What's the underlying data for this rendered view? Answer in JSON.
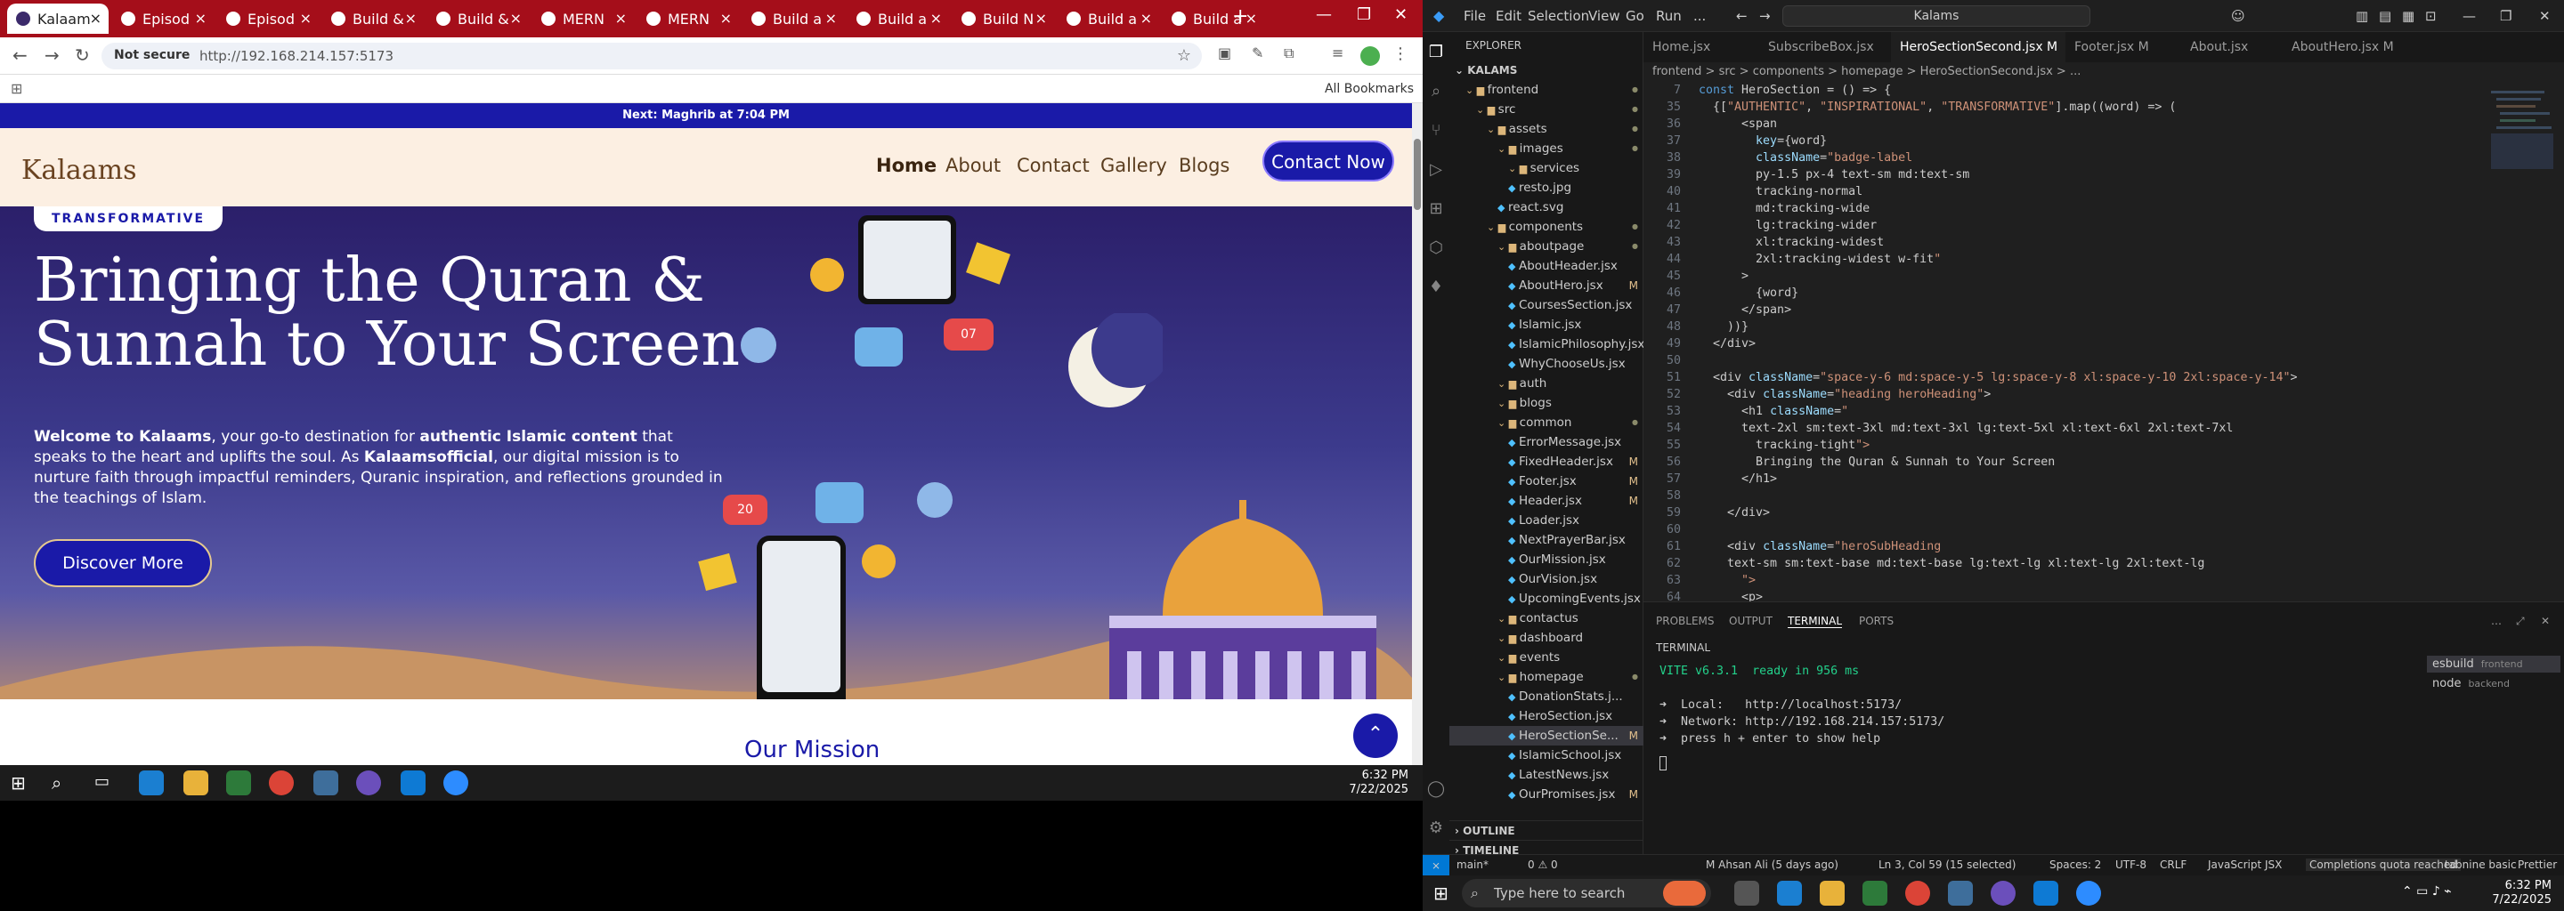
{
  "chrome": {
    "tabs": [
      {
        "label": "Kalaam",
        "active": true
      },
      {
        "label": "Episod",
        "active": false
      },
      {
        "label": "Episod",
        "active": false
      },
      {
        "label": "Build &",
        "active": false
      },
      {
        "label": "Build &",
        "active": false
      },
      {
        "label": "MERN",
        "active": false
      },
      {
        "label": "MERN",
        "active": false
      },
      {
        "label": "Build a",
        "active": false
      },
      {
        "label": "Build a",
        "active": false
      },
      {
        "label": "Build N",
        "active": false
      },
      {
        "label": "Build a",
        "active": false
      },
      {
        "label": "Build a",
        "active": false
      }
    ],
    "new_tab": "+",
    "not_secure": "Not secure",
    "url": "http://192.168.214.157:5173",
    "all_bookmarks": "All Bookmarks"
  },
  "site": {
    "prayer_bar": "Next: Maghrib at 7:04 PM",
    "logo": "Kalaams",
    "nav": [
      "Home",
      "About",
      "Contact",
      "Gallery",
      "Blogs"
    ],
    "cta": "Contact Now",
    "badge": "TRANSFORMATIVE",
    "hero_title": "Bringing the Quran & Sunnah to Your Screen",
    "hero_sub_1": "Welcome to Kalaams",
    "hero_sub_2": ", your go-to destination for ",
    "hero_sub_3": "authentic Islamic content",
    "hero_sub_4": " that speaks to the heart and uplifts the soul. As ",
    "hero_sub_5": "Kalaamsofficial",
    "hero_sub_6": ", our digital mission is to nurture faith through impactful reminders, Quranic inspiration, and reflections grounded in the teachings of Islam.",
    "discover": "Discover More",
    "mission_title": "Our Mission",
    "bubble_count_1": "20",
    "bubble_count_2": "07"
  },
  "left_taskbar": {
    "time": "6:32 PM",
    "date": "7/22/2025"
  },
  "vscode": {
    "menus": [
      "File",
      "Edit",
      "Selection",
      "View",
      "Go",
      "Run",
      "..."
    ],
    "command_center": "Kalams",
    "explorer_title": "EXPLORER",
    "workspace": "KALAMS",
    "tree": [
      {
        "label": "frontend",
        "indent": 1,
        "type": "folder",
        "mod": "dot"
      },
      {
        "label": "src",
        "indent": 2,
        "type": "folder",
        "mod": "dot"
      },
      {
        "label": "assets",
        "indent": 3,
        "type": "folder",
        "mod": "dot"
      },
      {
        "label": "images",
        "indent": 4,
        "type": "folder",
        "mod": "dot"
      },
      {
        "label": "services",
        "indent": 5,
        "type": "folder",
        "mod": ""
      },
      {
        "label": "resto.jpg",
        "indent": 5,
        "type": "file",
        "mod": ""
      },
      {
        "label": "react.svg",
        "indent": 4,
        "type": "file",
        "mod": ""
      },
      {
        "label": "components",
        "indent": 3,
        "type": "folder",
        "mod": "dot"
      },
      {
        "label": "aboutpage",
        "indent": 4,
        "type": "folder",
        "mod": "dot"
      },
      {
        "label": "AboutHeader.jsx",
        "indent": 5,
        "type": "file",
        "mod": ""
      },
      {
        "label": "AboutHero.jsx",
        "indent": 5,
        "type": "file",
        "mod": "M"
      },
      {
        "label": "CoursesSection.jsx",
        "indent": 5,
        "type": "file",
        "mod": ""
      },
      {
        "label": "Islamic.jsx",
        "indent": 5,
        "type": "file",
        "mod": ""
      },
      {
        "label": "IslamicPhilosophy.jsx",
        "indent": 5,
        "type": "file",
        "mod": ""
      },
      {
        "label": "WhyChooseUs.jsx",
        "indent": 5,
        "type": "file",
        "mod": ""
      },
      {
        "label": "auth",
        "indent": 4,
        "type": "folder",
        "mod": ""
      },
      {
        "label": "blogs",
        "indent": 4,
        "type": "folder",
        "mod": ""
      },
      {
        "label": "common",
        "indent": 4,
        "type": "folder",
        "mod": "dot"
      },
      {
        "label": "ErrorMessage.jsx",
        "indent": 5,
        "type": "file",
        "mod": ""
      },
      {
        "label": "FixedHeader.jsx",
        "indent": 5,
        "type": "file",
        "mod": "M"
      },
      {
        "label": "Footer.jsx",
        "indent": 5,
        "type": "file",
        "mod": "M"
      },
      {
        "label": "Header.jsx",
        "indent": 5,
        "type": "file",
        "mod": "M"
      },
      {
        "label": "Loader.jsx",
        "indent": 5,
        "type": "file",
        "mod": ""
      },
      {
        "label": "NextPrayerBar.jsx",
        "indent": 5,
        "type": "file",
        "mod": ""
      },
      {
        "label": "OurMission.jsx",
        "indent": 5,
        "type": "file",
        "mod": ""
      },
      {
        "label": "OurVision.jsx",
        "indent": 5,
        "type": "file",
        "mod": ""
      },
      {
        "label": "UpcomingEvents.jsx",
        "indent": 5,
        "type": "file",
        "mod": ""
      },
      {
        "label": "contactus",
        "indent": 4,
        "type": "folder",
        "mod": ""
      },
      {
        "label": "dashboard",
        "indent": 4,
        "type": "folder",
        "mod": ""
      },
      {
        "label": "events",
        "indent": 4,
        "type": "folder",
        "mod": ""
      },
      {
        "label": "homepage",
        "indent": 4,
        "type": "folder",
        "mod": "dot"
      },
      {
        "label": "DonationStats.j...",
        "indent": 5,
        "type": "file",
        "mod": ""
      },
      {
        "label": "HeroSection.jsx",
        "indent": 5,
        "type": "file",
        "mod": ""
      },
      {
        "label": "HeroSectionSe...",
        "indent": 5,
        "type": "file",
        "mod": "M",
        "selected": true
      },
      {
        "label": "IslamicSchool.jsx",
        "indent": 5,
        "type": "file",
        "mod": ""
      },
      {
        "label": "LatestNews.jsx",
        "indent": 5,
        "type": "file",
        "mod": ""
      },
      {
        "label": "OurPromises.jsx",
        "indent": 5,
        "type": "file",
        "mod": "M"
      }
    ],
    "outline": "OUTLINE",
    "timeline": "TIMELINE",
    "editor_tabs": [
      {
        "label": "Home.jsx",
        "active": false
      },
      {
        "label": "SubscribeBox.jsx",
        "active": false
      },
      {
        "label": "HeroSectionSecond.jsx M",
        "active": true
      },
      {
        "label": "Footer.jsx M",
        "active": false
      },
      {
        "label": "About.jsx",
        "active": false
      },
      {
        "label": "AboutHero.jsx M",
        "active": false
      }
    ],
    "breadcrumbs": "frontend > src > components > homepage > HeroSectionSecond.jsx > ...",
    "code_lines": [
      {
        "n": "7",
        "t": "const HeroSection = () => {"
      },
      {
        "n": "35",
        "t": "  {[\"AUTHENTIC\", \"INSPIRATIONAL\", \"TRANSFORMATIVE\"].map((word) => ("
      },
      {
        "n": "36",
        "t": "      <span"
      },
      {
        "n": "37",
        "t": "        key={word}"
      },
      {
        "n": "38",
        "t": "        className=\"badge-label"
      },
      {
        "n": "39",
        "t": "        py-1.5 px-4 text-sm md:text-sm"
      },
      {
        "n": "40",
        "t": "        tracking-normal"
      },
      {
        "n": "41",
        "t": "        md:tracking-wide"
      },
      {
        "n": "42",
        "t": "        lg:tracking-wider"
      },
      {
        "n": "43",
        "t": "        xl:tracking-widest"
      },
      {
        "n": "44",
        "t": "        2xl:tracking-widest w-fit\""
      },
      {
        "n": "45",
        "t": "      >"
      },
      {
        "n": "46",
        "t": "        {word}"
      },
      {
        "n": "47",
        "t": "      </span>"
      },
      {
        "n": "48",
        "t": "    ))}"
      },
      {
        "n": "49",
        "t": "  </div>"
      },
      {
        "n": "50",
        "t": ""
      },
      {
        "n": "51",
        "t": "  <div className=\"space-y-6 md:space-y-5 lg:space-y-8 xl:space-y-10 2xl:space-y-14\">"
      },
      {
        "n": "52",
        "t": "    <div className=\"heading heroHeading\">"
      },
      {
        "n": "53",
        "t": "      <h1 className=\""
      },
      {
        "n": "54",
        "t": "      text-2xl sm:text-3xl md:text-3xl lg:text-5xl xl:text-6xl 2xl:text-7xl"
      },
      {
        "n": "55",
        "t": "        tracking-tight\">"
      },
      {
        "n": "56",
        "t": "        Bringing the Quran & Sunnah to Your Screen"
      },
      {
        "n": "57",
        "t": "      </h1>"
      },
      {
        "n": "58",
        "t": ""
      },
      {
        "n": "59",
        "t": "    </div>"
      },
      {
        "n": "60",
        "t": ""
      },
      {
        "n": "61",
        "t": "    <div className=\"heroSubHeading"
      },
      {
        "n": "62",
        "t": "    text-sm sm:text-base md:text-base lg:text-lg xl:text-lg 2xl:text-lg"
      },
      {
        "n": "63",
        "t": "      \">"
      },
      {
        "n": "64",
        "t": "      <p>"
      }
    ],
    "panel_tabs": [
      "PROBLEMS",
      "OUTPUT",
      "TERMINAL",
      "PORTS"
    ],
    "terminal_label": "TERMINAL",
    "terminal": [
      "VITE v6.3.1  ready in 956 ms",
      "",
      "➜  Local:   http://localhost:5173/",
      "➜  Network: http://192.168.214.157:5173/",
      "➜  press h + enter to show help"
    ],
    "terminal_list": [
      {
        "label": "esbuild",
        "sub": "frontend"
      },
      {
        "label": "node",
        "sub": "backend"
      }
    ],
    "status": {
      "branch": "main*",
      "errors": "0 ⚠ 0",
      "author": "M Ahsan Ali (5 days ago)",
      "position": "Ln 3, Col 59 (15 selected)",
      "spaces": "Spaces: 2",
      "encoding": "UTF-8",
      "eol": "CRLF",
      "language": "JavaScript JSX",
      "copilot": "Completions quota reached",
      "tabnine": "tabnine basic",
      "prettier": "Prettier"
    }
  },
  "right_taskbar": {
    "search": "Type here to search",
    "time": "6:32 PM",
    "date": "7/22/2025"
  },
  "colors": {
    "brand_blue": "#1a1aa8",
    "chrome_red": "#a50e1a",
    "vs_bg": "#1f1f1f"
  }
}
